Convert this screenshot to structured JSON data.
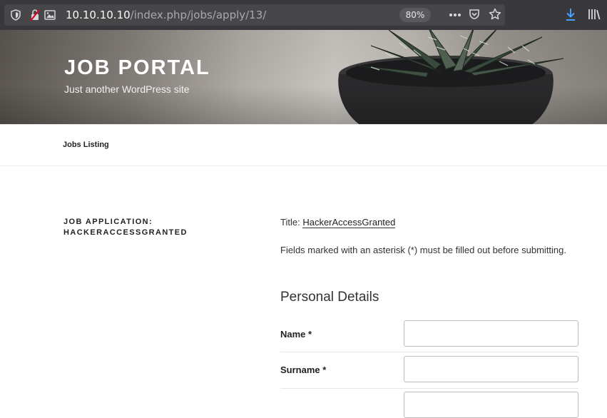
{
  "browser": {
    "url_host": "10.10.10.10",
    "url_path": "/index.php/jobs/apply/13/",
    "zoom": "80%",
    "icons": [
      "shield-icon",
      "insecure-lock-icon",
      "image-icon",
      "more-icon",
      "pocket-icon",
      "bookmark-star-icon",
      "download-icon",
      "library-icon"
    ]
  },
  "header": {
    "site_title": "JOB PORTAL",
    "tagline": "Just another WordPress site"
  },
  "nav": {
    "items": [
      {
        "label": "Jobs Listing"
      }
    ]
  },
  "job": {
    "heading_line1": "JOB APPLICATION:",
    "heading_line2": "HACKERACCESSGRANTED",
    "title_label": "Title:",
    "title_value": "HackerAccessGranted",
    "notice": "Fields marked with an asterisk (*) must be filled out before submitting."
  },
  "form": {
    "section_title": "Personal Details",
    "fields": [
      {
        "label": "Name *",
        "value": ""
      },
      {
        "label": "Surname *",
        "value": ""
      }
    ]
  },
  "colors": {
    "toolbar_bg": "#38383d",
    "urlbar_bg": "#474749",
    "download_accent": "#45a1ff",
    "insecure_red": "#d70022"
  }
}
